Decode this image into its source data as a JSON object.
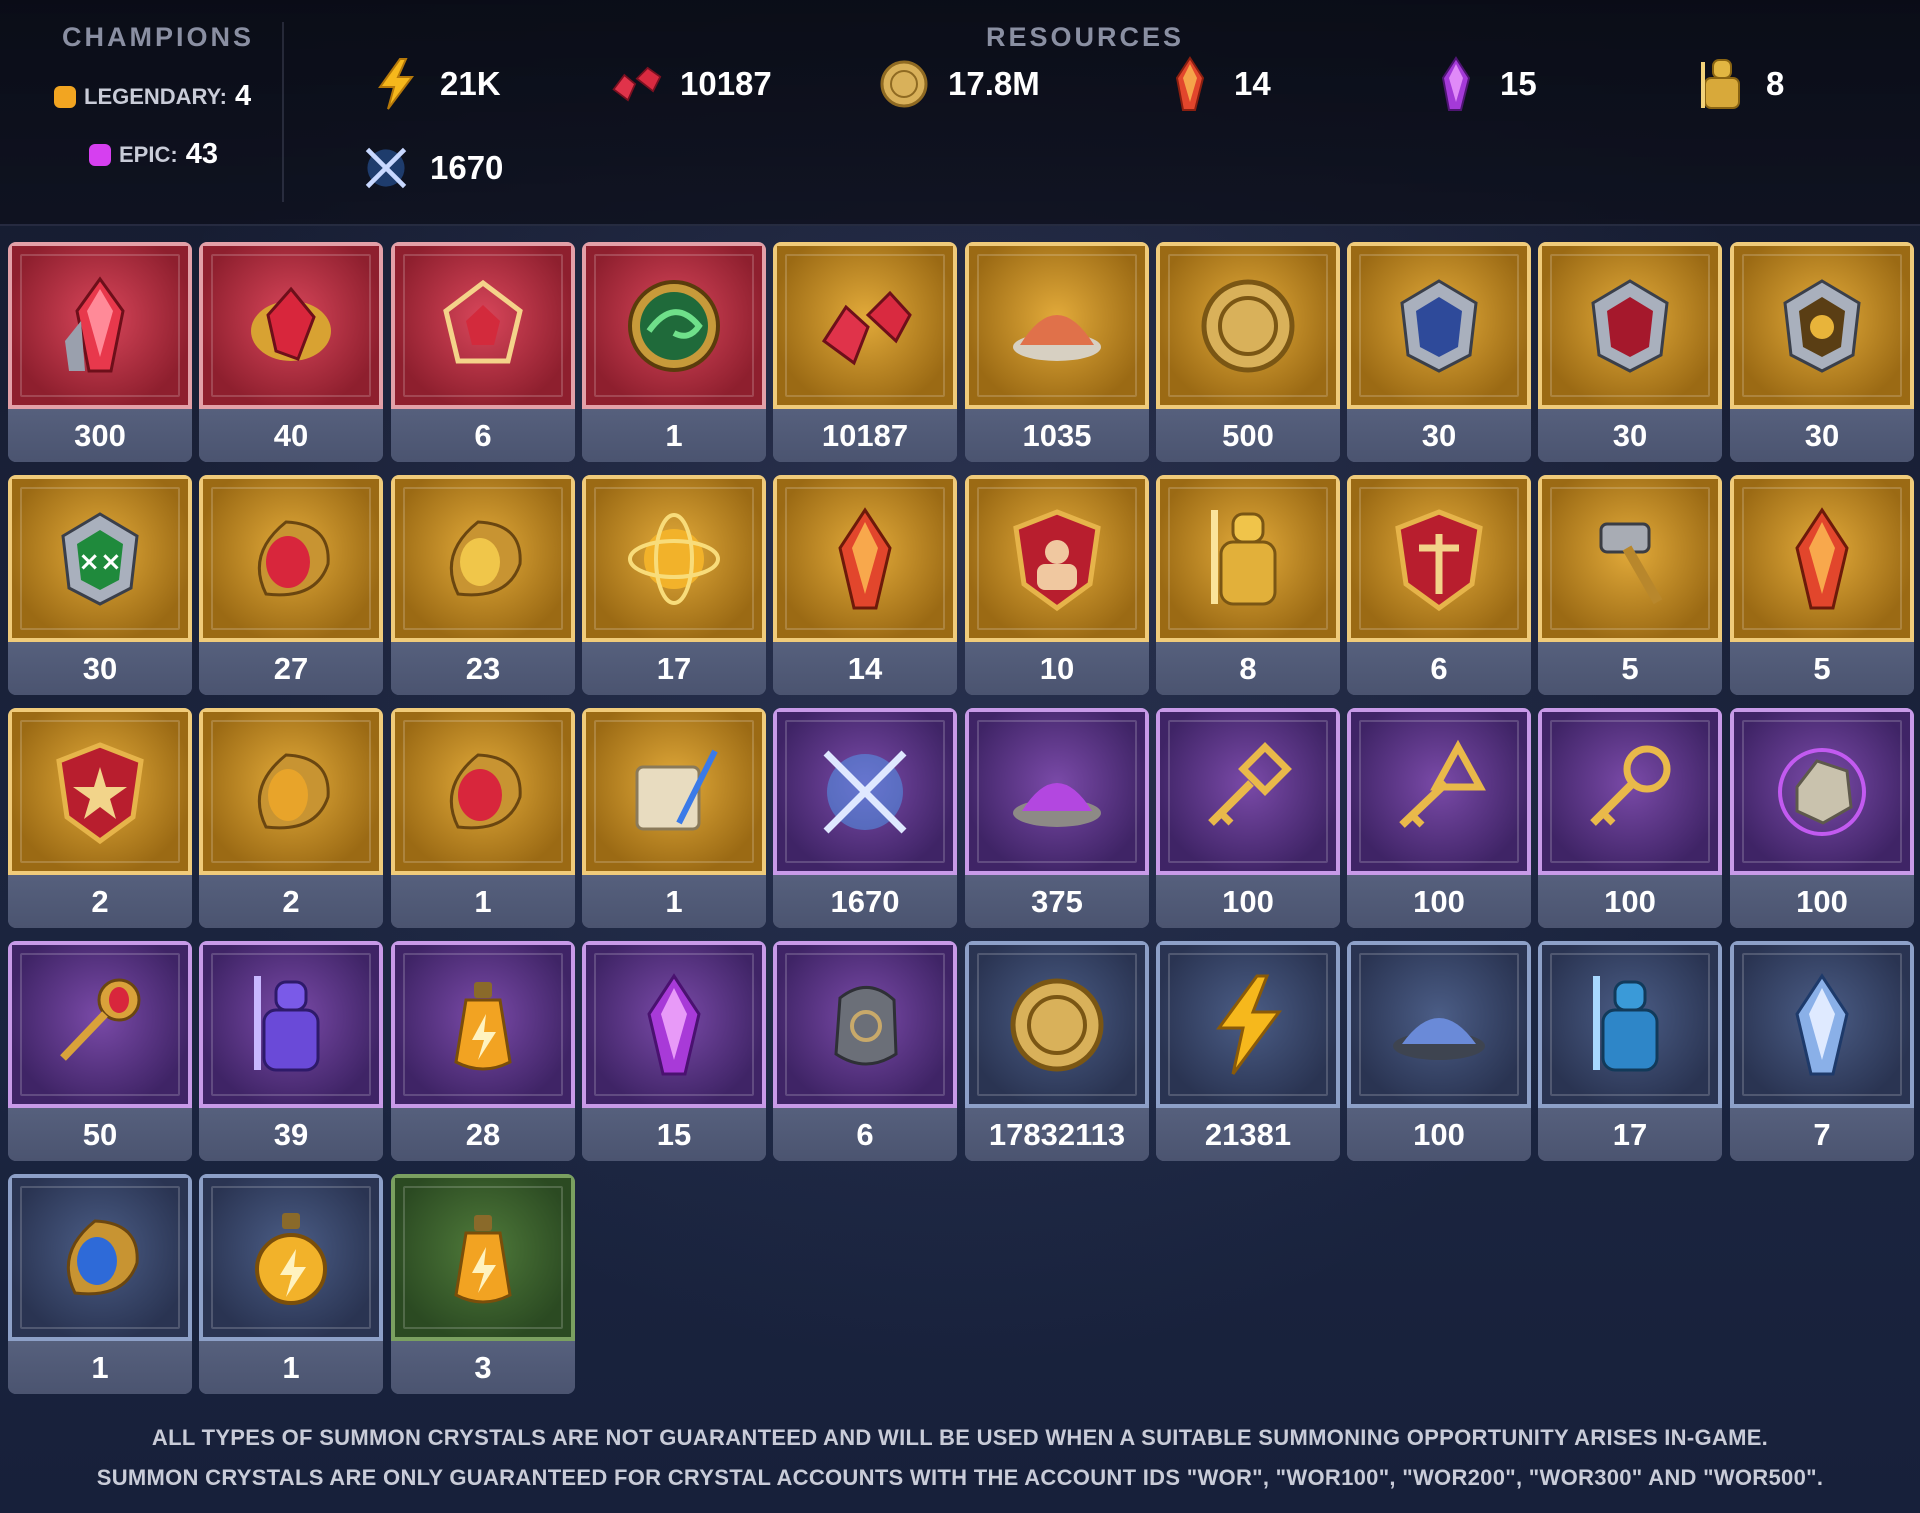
{
  "champions": {
    "title": "CHAMPIONS",
    "legendary": {
      "label": "LEGENDARY:",
      "count": "4",
      "color": "#f2a521"
    },
    "epic": {
      "label": "EPIC:",
      "count": "43",
      "color": "#d63ff0"
    }
  },
  "resources": {
    "title": "RESOURCES",
    "items": [
      {
        "icon": "energy-icon",
        "value": "21K"
      },
      {
        "icon": "rubies-icon",
        "value": "10187"
      },
      {
        "icon": "gold-coin-icon",
        "value": "17.8M"
      },
      {
        "icon": "fire-crystal-icon",
        "value": "14"
      },
      {
        "icon": "void-crystal-icon",
        "value": "15"
      },
      {
        "icon": "golden-knight-icon",
        "value": "8"
      },
      {
        "icon": "arena-token-icon",
        "value": "1670"
      }
    ]
  },
  "tiles": [
    {
      "icon": "red-crystal-icon",
      "rarity": "red",
      "count": "300"
    },
    {
      "icon": "red-gem-cluster-icon",
      "rarity": "red",
      "count": "40"
    },
    {
      "icon": "red-cube-gem-icon",
      "rarity": "red",
      "count": "6"
    },
    {
      "icon": "chameleon-medallion-icon",
      "rarity": "red",
      "count": "1"
    },
    {
      "icon": "rubies-icon",
      "rarity": "gold",
      "count": "10187"
    },
    {
      "icon": "ore-pile-icon",
      "rarity": "gold",
      "count": "1035"
    },
    {
      "icon": "gold-coin-icon",
      "rarity": "gold",
      "count": "500"
    },
    {
      "icon": "blue-shard-shield-icon",
      "rarity": "gold",
      "count": "30"
    },
    {
      "icon": "red-shard-shield-icon",
      "rarity": "gold",
      "count": "30"
    },
    {
      "icon": "gold-shard-shield-icon",
      "rarity": "gold",
      "count": "30"
    },
    {
      "icon": "green-shard-shield-icon",
      "rarity": "gold",
      "count": "30"
    },
    {
      "icon": "ruby-amulet-icon",
      "rarity": "gold",
      "count": "27"
    },
    {
      "icon": "gold-amulet-icon",
      "rarity": "gold",
      "count": "23"
    },
    {
      "icon": "golden-orb-icon",
      "rarity": "gold",
      "count": "17"
    },
    {
      "icon": "fire-crystal-icon",
      "rarity": "gold",
      "count": "14"
    },
    {
      "icon": "strength-crest-icon",
      "rarity": "gold",
      "count": "10"
    },
    {
      "icon": "golden-knight-icon",
      "rarity": "gold",
      "count": "8"
    },
    {
      "icon": "red-crest-icon",
      "rarity": "gold",
      "count": "6"
    },
    {
      "icon": "hammer-icon",
      "rarity": "gold",
      "count": "5"
    },
    {
      "icon": "fire-crystal-icon",
      "rarity": "gold",
      "count": "5"
    },
    {
      "icon": "star-crest-icon",
      "rarity": "gold",
      "count": "2"
    },
    {
      "icon": "topaz-amulet-icon",
      "rarity": "gold",
      "count": "2"
    },
    {
      "icon": "ruby-amulet-icon",
      "rarity": "gold",
      "count": "1"
    },
    {
      "icon": "scroll-quill-icon",
      "rarity": "gold",
      "count": "1"
    },
    {
      "icon": "crossed-swords-icon",
      "rarity": "purple",
      "count": "1670"
    },
    {
      "icon": "purple-dust-icon",
      "rarity": "purple",
      "count": "375"
    },
    {
      "icon": "diamond-key-icon",
      "rarity": "purple",
      "count": "100"
    },
    {
      "icon": "triangle-key-icon",
      "rarity": "purple",
      "count": "100"
    },
    {
      "icon": "ring-key-icon",
      "rarity": "purple",
      "count": "100"
    },
    {
      "icon": "silver-ore-icon",
      "rarity": "purple",
      "count": "100"
    },
    {
      "icon": "ruby-key-icon",
      "rarity": "purple",
      "count": "50"
    },
    {
      "icon": "purple-knight-icon",
      "rarity": "purple",
      "count": "39"
    },
    {
      "icon": "energy-potion-icon",
      "rarity": "purple",
      "count": "28"
    },
    {
      "icon": "void-crystal-icon",
      "rarity": "purple",
      "count": "15"
    },
    {
      "icon": "rune-stone-icon",
      "rarity": "purple",
      "count": "6"
    },
    {
      "icon": "gold-coin-icon",
      "rarity": "blue",
      "count": "17832113"
    },
    {
      "icon": "energy-icon",
      "rarity": "blue",
      "count": "21381"
    },
    {
      "icon": "blue-dust-icon",
      "rarity": "blue",
      "count": "100"
    },
    {
      "icon": "blue-knight-icon",
      "rarity": "blue",
      "count": "17"
    },
    {
      "icon": "blue-crystal-icon",
      "rarity": "blue",
      "count": "7"
    },
    {
      "icon": "sapphire-amulet-icon",
      "rarity": "blue",
      "count": "1"
    },
    {
      "icon": "energy-flask-icon",
      "rarity": "blue",
      "count": "1"
    },
    {
      "icon": "energy-potion-icon",
      "rarity": "green",
      "count": "3"
    }
  ],
  "footer": {
    "line1": "ALL TYPES OF SUMMON CRYSTALS ARE NOT GUARANTEED AND WILL BE USED WHEN A SUITABLE SUMMONING OPPORTUNITY ARISES IN-GAME.",
    "line2": "SUMMON CRYSTALS ARE ONLY GUARANTEED FOR CRYSTAL ACCOUNTS WITH THE ACCOUNT IDS \"WOR\", \"WOR100\", \"WOR200\", \"WOR300\" AND \"WOR500\"."
  }
}
